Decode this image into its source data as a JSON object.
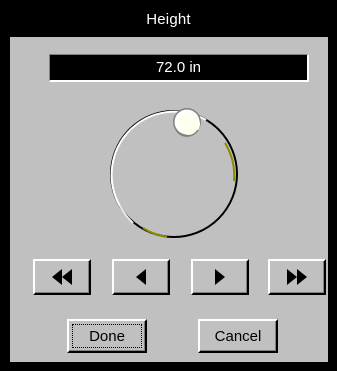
{
  "dialog": {
    "title": "Height",
    "value_display": "72.0 in",
    "dial": {
      "knob_angle_degrees": 340,
      "accent_color": "#8a8a00"
    },
    "nav_buttons": [
      {
        "icon": "fast-rewind-icon",
        "glyph": "◀◀"
      },
      {
        "icon": "step-back-icon",
        "glyph": "◀"
      },
      {
        "icon": "step-forward-icon",
        "glyph": "▶"
      },
      {
        "icon": "fast-forward-icon",
        "glyph": "▶▶"
      }
    ],
    "done_label": "Done",
    "cancel_label": "Cancel"
  }
}
